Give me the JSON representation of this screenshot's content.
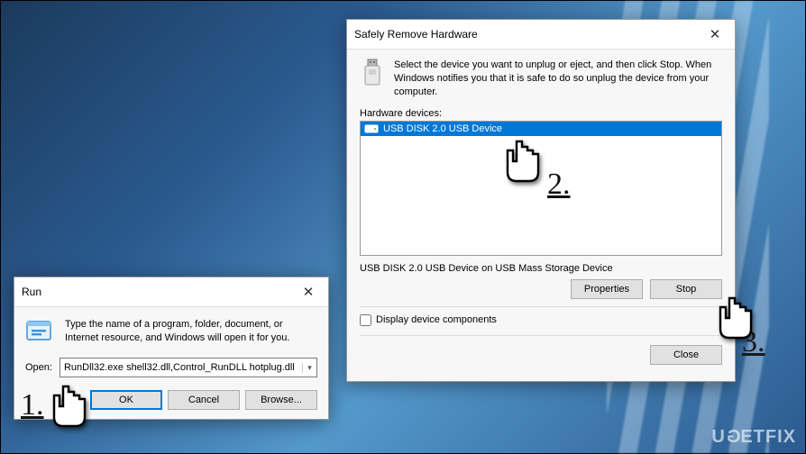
{
  "run": {
    "title": "Run",
    "description": "Type the name of a program, folder, document, or Internet resource, and Windows will open it for you.",
    "open_label": "Open:",
    "open_value": "RunDll32.exe shell32.dll,Control_RunDLL hotplug.dll",
    "ok": "OK",
    "cancel": "Cancel",
    "browse": "Browse..."
  },
  "srh": {
    "title": "Safely Remove Hardware",
    "description": "Select the device you want to unplug or eject, and then click Stop. When Windows notifies you that it is safe to do so unplug the device from your computer.",
    "hw_label": "Hardware devices:",
    "devices": [
      {
        "name": "USB DISK 2.0 USB Device",
        "selected": true
      }
    ],
    "selected_device_text": "USB DISK 2.0 USB Device on USB Mass Storage Device",
    "properties": "Properties",
    "stop": "Stop",
    "display_components": "Display device components",
    "close": "Close"
  },
  "steps": {
    "s1": "1.",
    "s2": "2.",
    "s3": "3."
  },
  "watermark": "UGETFIX"
}
